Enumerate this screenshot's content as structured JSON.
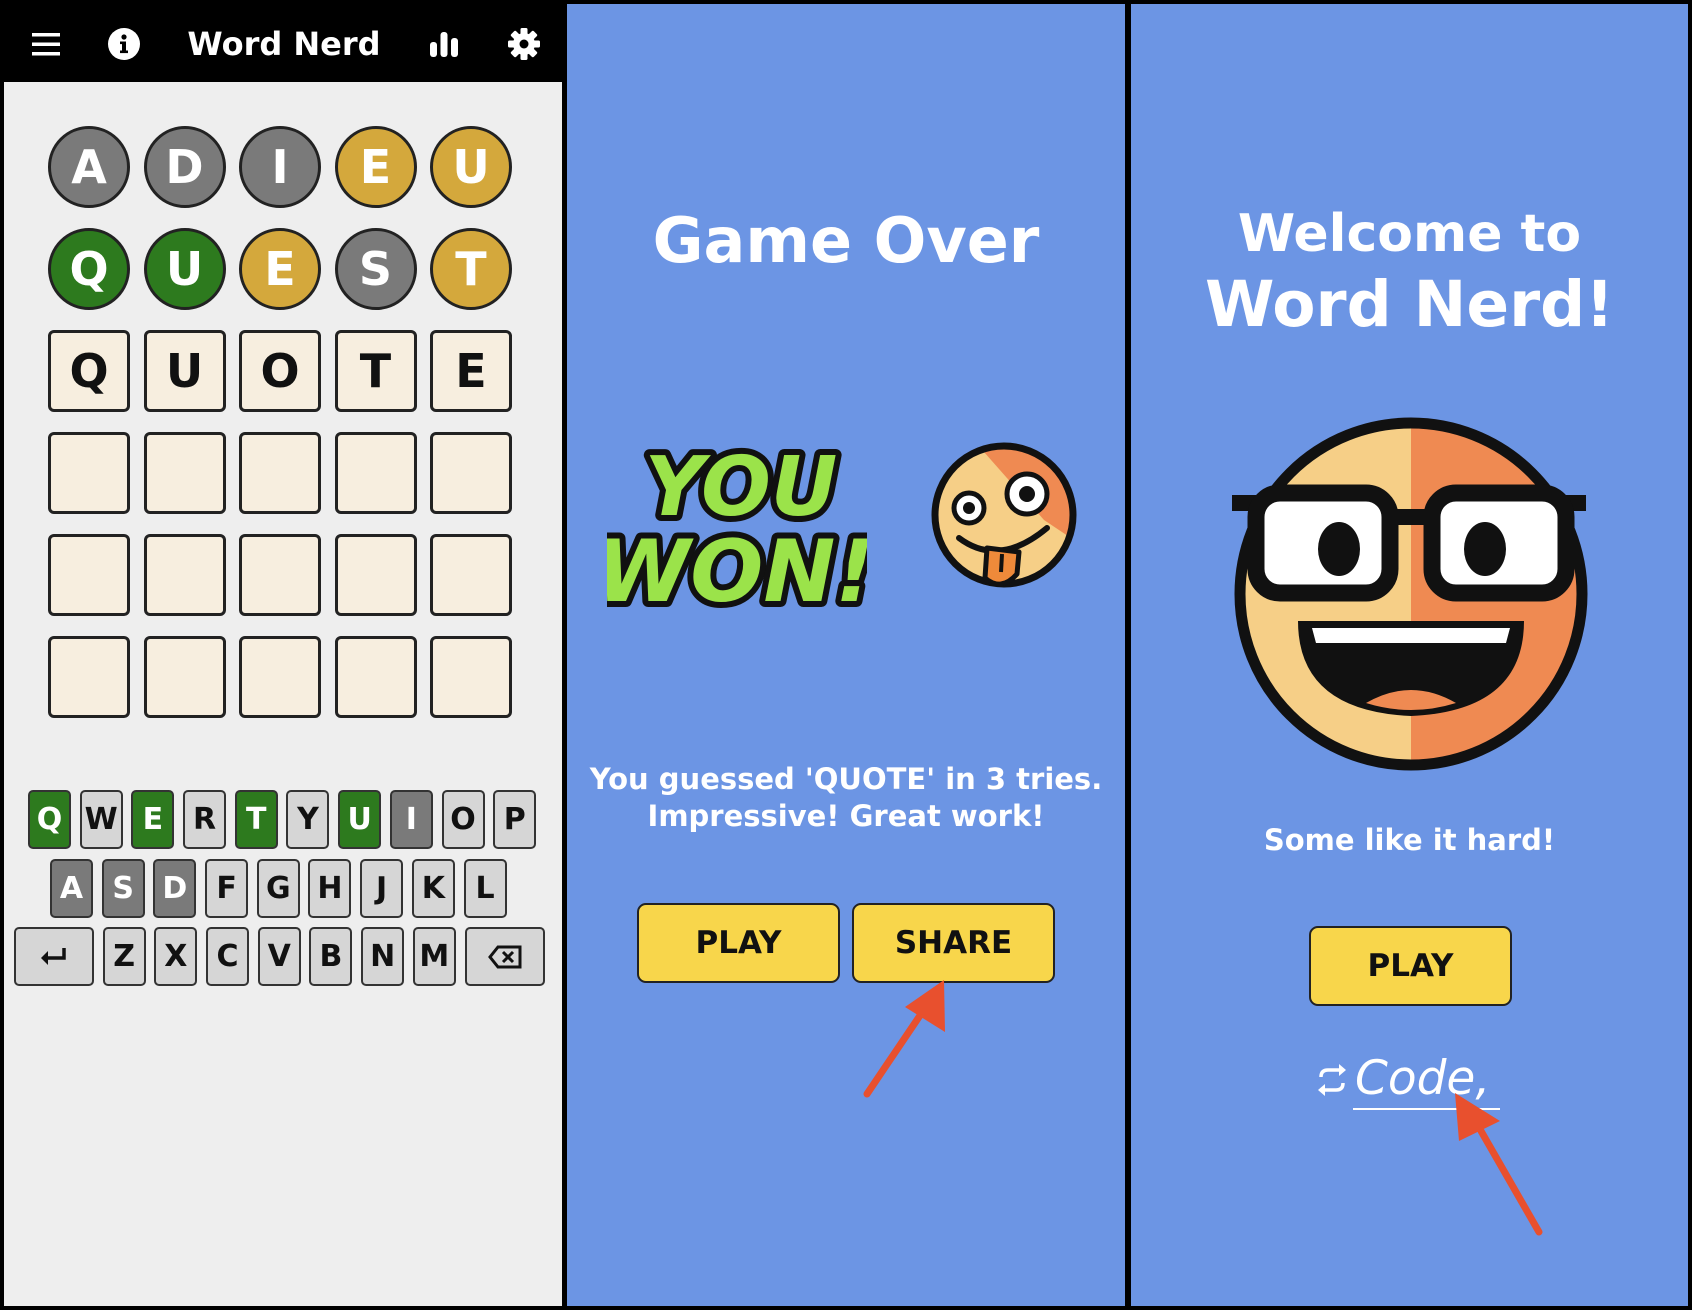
{
  "header": {
    "title": "Word Nerd",
    "icons": [
      "menu-icon",
      "info-icon",
      "stats-icon",
      "settings-icon"
    ]
  },
  "board": {
    "rows": [
      {
        "style": "round",
        "tiles": [
          {
            "letter": "A",
            "state": "absent"
          },
          {
            "letter": "D",
            "state": "absent"
          },
          {
            "letter": "I",
            "state": "absent"
          },
          {
            "letter": "E",
            "state": "present"
          },
          {
            "letter": "U",
            "state": "present"
          }
        ]
      },
      {
        "style": "round",
        "tiles": [
          {
            "letter": "Q",
            "state": "correct"
          },
          {
            "letter": "U",
            "state": "correct"
          },
          {
            "letter": "E",
            "state": "present"
          },
          {
            "letter": "S",
            "state": "absent"
          },
          {
            "letter": "T",
            "state": "present"
          }
        ]
      },
      {
        "style": "square",
        "tiles": [
          {
            "letter": "Q",
            "state": "entered"
          },
          {
            "letter": "U",
            "state": "entered"
          },
          {
            "letter": "O",
            "state": "entered"
          },
          {
            "letter": "T",
            "state": "entered"
          },
          {
            "letter": "E",
            "state": "entered"
          }
        ]
      },
      {
        "style": "square",
        "tiles": [
          {
            "letter": "",
            "state": "empty"
          },
          {
            "letter": "",
            "state": "empty"
          },
          {
            "letter": "",
            "state": "empty"
          },
          {
            "letter": "",
            "state": "empty"
          },
          {
            "letter": "",
            "state": "empty"
          }
        ]
      },
      {
        "style": "square",
        "tiles": [
          {
            "letter": "",
            "state": "empty"
          },
          {
            "letter": "",
            "state": "empty"
          },
          {
            "letter": "",
            "state": "empty"
          },
          {
            "letter": "",
            "state": "empty"
          },
          {
            "letter": "",
            "state": "empty"
          }
        ]
      },
      {
        "style": "square",
        "tiles": [
          {
            "letter": "",
            "state": "empty"
          },
          {
            "letter": "",
            "state": "empty"
          },
          {
            "letter": "",
            "state": "empty"
          },
          {
            "letter": "",
            "state": "empty"
          },
          {
            "letter": "",
            "state": "empty"
          }
        ]
      }
    ]
  },
  "keyboard": {
    "rows": [
      [
        {
          "key": "Q",
          "state": "correct"
        },
        {
          "key": "W",
          "state": "unused"
        },
        {
          "key": "E",
          "state": "correct"
        },
        {
          "key": "R",
          "state": "unused"
        },
        {
          "key": "T",
          "state": "correct"
        },
        {
          "key": "Y",
          "state": "unused"
        },
        {
          "key": "U",
          "state": "correct"
        },
        {
          "key": "I",
          "state": "absent"
        },
        {
          "key": "O",
          "state": "unused"
        },
        {
          "key": "P",
          "state": "unused"
        }
      ],
      [
        {
          "key": "A",
          "state": "absent"
        },
        {
          "key": "S",
          "state": "absent"
        },
        {
          "key": "D",
          "state": "absent"
        },
        {
          "key": "F",
          "state": "unused"
        },
        {
          "key": "G",
          "state": "unused"
        },
        {
          "key": "H",
          "state": "unused"
        },
        {
          "key": "J",
          "state": "unused"
        },
        {
          "key": "K",
          "state": "unused"
        },
        {
          "key": "L",
          "state": "unused"
        }
      ],
      [
        {
          "key": "",
          "state": "enter",
          "icon": "enter-icon"
        },
        {
          "key": "Z",
          "state": "unused"
        },
        {
          "key": "X",
          "state": "unused"
        },
        {
          "key": "C",
          "state": "unused"
        },
        {
          "key": "V",
          "state": "unused"
        },
        {
          "key": "B",
          "state": "unused"
        },
        {
          "key": "N",
          "state": "unused"
        },
        {
          "key": "M",
          "state": "unused"
        },
        {
          "key": "",
          "state": "backspace",
          "icon": "backspace-icon"
        }
      ]
    ]
  },
  "game_over": {
    "title": "Game Over",
    "sticker_line1": "YOU",
    "sticker_line2": "WON!",
    "message_line1": "You guessed 'QUOTE' in 3 tries.",
    "message_line2": "Impressive! Great work!",
    "play_label": "PLAY",
    "share_label": "SHARE"
  },
  "welcome": {
    "title_line1": "Welcome to",
    "title_line2": "Word Nerd!",
    "tagline": "Some like it hard!",
    "play_label": "PLAY",
    "code_label": "Code,"
  },
  "colors": {
    "correct": "#2d7a1e",
    "present": "#d4a83c",
    "absent": "#7a7a7a",
    "panel_blue": "#6c95e4",
    "button_yellow": "#f8d64b",
    "arrow": "#e8502e",
    "sticker_green": "#9be34a"
  }
}
